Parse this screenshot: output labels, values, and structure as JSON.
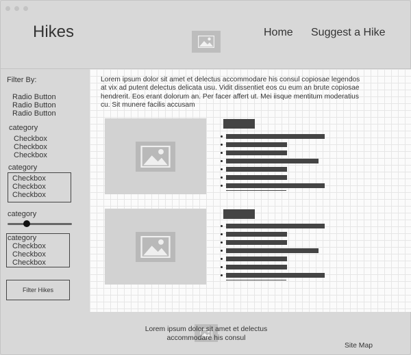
{
  "header": {
    "brand": "Hikes",
    "nav": [
      "Home",
      "Suggest a Hike"
    ],
    "logo_icon": "image-icon"
  },
  "sidebar": {
    "filter_label": "Filter By:",
    "radios": [
      "Radio Button",
      "Radio Button",
      "Radio Button"
    ],
    "group1": {
      "title": "category",
      "items": [
        "Checkbox",
        "Checkbox",
        "Checkbox"
      ]
    },
    "group2": {
      "title": "category",
      "items": [
        "Checkbox",
        "Checkbox",
        "Checkbox"
      ]
    },
    "slider": {
      "title": "category",
      "value": 0.3
    },
    "group3": {
      "title": "category",
      "items": [
        "Checkbox",
        "Checkbox",
        "Checkbox"
      ]
    },
    "filter_button": "Filter Hikes"
  },
  "main": {
    "intro": "Lorem ipsum dolor sit amet et delectus accommodare his consul copiosae legendos at vix ad putent delectus delicata usu. Vidit dissentiet eos cu eum an brute copiosae hendrerit. Eos erant dolorum an. Per facer affert ut. Mei iisque mentitum moderatius cu. Sit munere facilis accusam",
    "cards": [
      {
        "image_icon": "image-icon",
        "bullet_fills": [
          1.0,
          0.62,
          0.62,
          0.94,
          0.62,
          0.62,
          1.0
        ]
      },
      {
        "image_icon": "image-icon",
        "bullet_fills": [
          1.0,
          0.62,
          0.62,
          0.94,
          0.62,
          0.62,
          1.0
        ]
      }
    ]
  },
  "footer": {
    "text": "Lorem ipsum dolor sit amet et delectus accommodare his consul",
    "sitemap": "Site Map"
  },
  "colors": {
    "window": "#d8d8d8",
    "bar": "#444444",
    "placeholder": "#bdbdbd"
  }
}
